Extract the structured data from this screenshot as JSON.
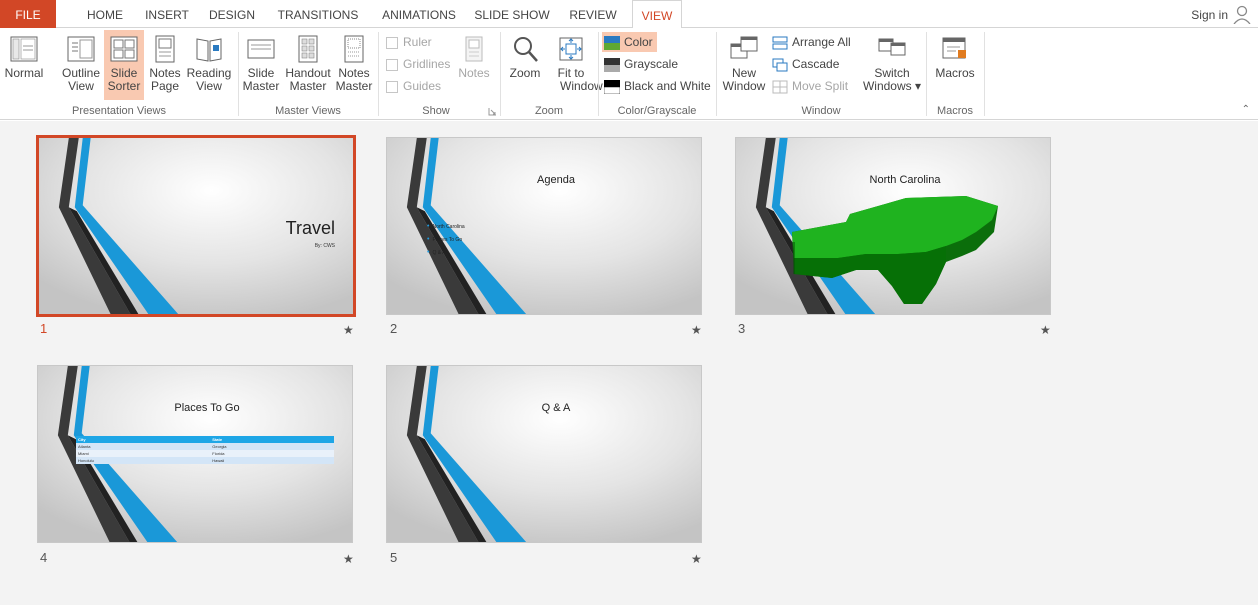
{
  "tabs": [
    {
      "id": "file",
      "label": "FILE"
    },
    {
      "id": "home",
      "label": "HOME"
    },
    {
      "id": "insert",
      "label": "INSERT"
    },
    {
      "id": "design",
      "label": "DESIGN"
    },
    {
      "id": "transitions",
      "label": "TRANSITIONS"
    },
    {
      "id": "animations",
      "label": "ANIMATIONS"
    },
    {
      "id": "slideshow",
      "label": "SLIDE SHOW"
    },
    {
      "id": "review",
      "label": "REVIEW"
    },
    {
      "id": "view",
      "label": "VIEW"
    }
  ],
  "active_tab": "VIEW",
  "signin": "Sign in",
  "ribbon": {
    "presentation_views": {
      "label": "Presentation Views",
      "normal": "Normal",
      "outline_1": "Outline",
      "outline_2": "View",
      "sorter_1": "Slide",
      "sorter_2": "Sorter",
      "notes_1": "Notes",
      "notes_2": "Page",
      "reading_1": "Reading",
      "reading_2": "View"
    },
    "master_views": {
      "label": "Master Views",
      "slide_1": "Slide",
      "slide_2": "Master",
      "handout_1": "Handout",
      "handout_2": "Master",
      "notes_1": "Notes",
      "notes_2": "Master"
    },
    "show": {
      "label": "Show",
      "ruler": "Ruler",
      "gridlines": "Gridlines",
      "guides": "Guides",
      "notes": "Notes"
    },
    "zoom": {
      "label": "Zoom",
      "zoom": "Zoom",
      "fit_1": "Fit to",
      "fit_2": "Window"
    },
    "color": {
      "label": "Color/Grayscale",
      "color": "Color",
      "grayscale": "Grayscale",
      "bw": "Black and White"
    },
    "window": {
      "label": "Window",
      "new_1": "New",
      "new_2": "Window",
      "arrange": "Arrange All",
      "cascade": "Cascade",
      "move_split": "Move Split",
      "switch_1": "Switch",
      "switch_2": "Windows ▾"
    },
    "macros": {
      "label": "Macros",
      "macros": "Macros"
    }
  },
  "slides": [
    {
      "number": "1",
      "title": "Travel",
      "subtitle": "By: CWS",
      "star": "★"
    },
    {
      "number": "2",
      "title": "Agenda",
      "bullets": [
        "North Carolina",
        "Places To Go",
        "Q & A"
      ],
      "star": "★"
    },
    {
      "number": "3",
      "title": "North Carolina",
      "star": "★"
    },
    {
      "number": "4",
      "title": "Places To Go",
      "star": "★",
      "table": {
        "headers": [
          "City",
          "State"
        ],
        "rows": [
          [
            "Atlanta",
            "Georgia"
          ],
          [
            "Miami",
            "Florida"
          ],
          [
            "Honolulu",
            "Hawaii"
          ]
        ]
      }
    },
    {
      "number": "5",
      "title": "Q & A",
      "star": "★"
    }
  ],
  "colors": {
    "accent": "#d24726",
    "selected_bg": "#f9c9b1",
    "slide_stripe_blue": "#1ea6e6",
    "map_green": "#1fb31f"
  }
}
